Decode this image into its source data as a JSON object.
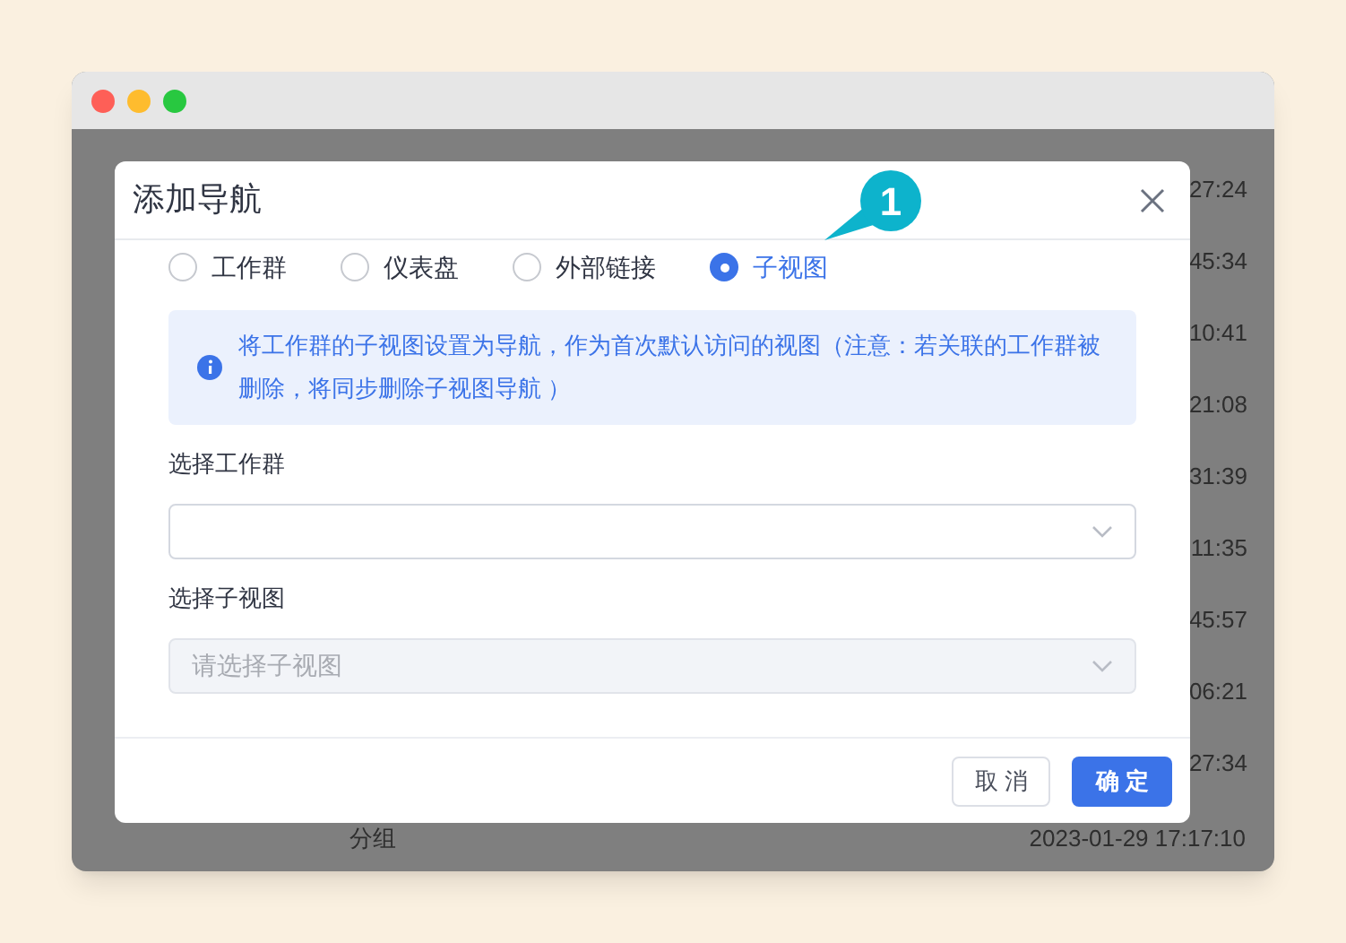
{
  "background_rows": [
    {
      "time": "27:24"
    },
    {
      "time": "45:34"
    },
    {
      "time": "10:41"
    },
    {
      "time": "21:08"
    },
    {
      "time": "31:39"
    },
    {
      "time": "11:35"
    },
    {
      "time": "45:57"
    },
    {
      "time": "06:21"
    },
    {
      "time": "27:34"
    }
  ],
  "background_last_row": {
    "name": "分组",
    "time": "2023-01-29 17:17:10"
  },
  "dialog": {
    "title": "添加导航",
    "options": [
      {
        "label": "工作群",
        "selected": false
      },
      {
        "label": "仪表盘",
        "selected": false
      },
      {
        "label": "外部链接",
        "selected": false
      },
      {
        "label": "子视图",
        "selected": true
      }
    ],
    "info": "将工作群的子视图设置为导航，作为首次默认访问的视图（注意：若关联的工作群被删除，将同步删除子视图导航 ）",
    "fields": [
      {
        "label": "选择工作群",
        "disabled": false
      },
      {
        "label": "选择子视图",
        "placeholder": "请选择子视图",
        "disabled": true
      }
    ],
    "buttons": [
      {
        "label": "取 消",
        "kind": "secondary"
      },
      {
        "label": "确 定",
        "kind": "primary"
      }
    ]
  },
  "callout": {
    "label": "1"
  }
}
